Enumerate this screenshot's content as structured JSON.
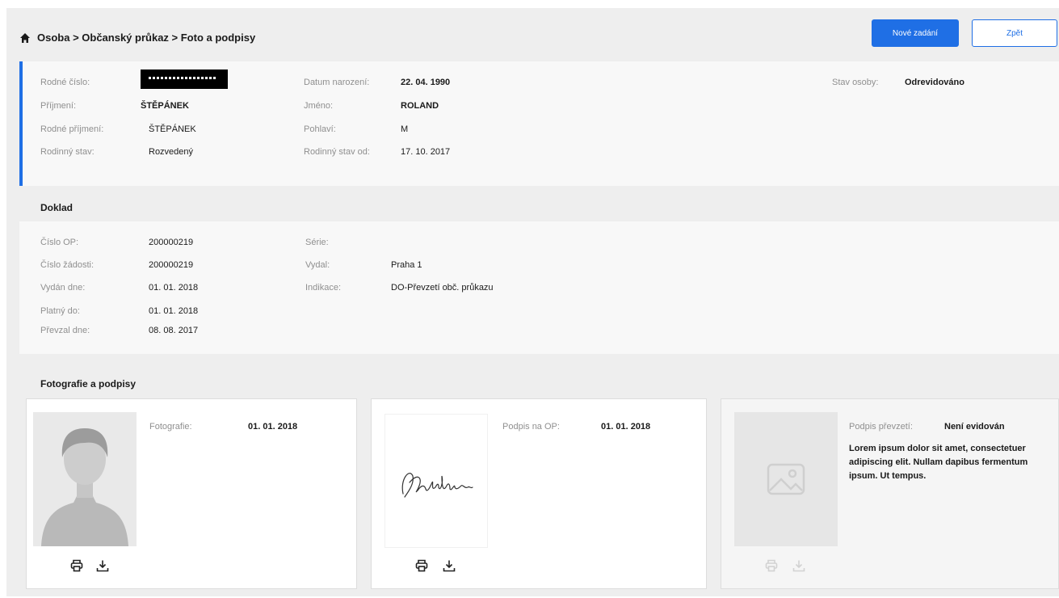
{
  "header": {
    "breadcrumb": "Osoba > Občanský průkaz > Foto a podpisy",
    "new_entry_label": "Nové zadání",
    "back_label": "Zpět"
  },
  "person": {
    "rodne_cislo_label": "Rodné číslo:",
    "prijmeni_label": "Příjmení:",
    "prijmeni": "ŠTĚPÁNEK",
    "rodne_prijmeni_label": "Rodné příjmení:",
    "rodne_prijmeni": "ŠTĚPÁNEK",
    "rodinny_stav_label": "Rodinný stav:",
    "rodinny_stav": "Rozvedený",
    "datum_narozeni_label": "Datum narození:",
    "datum_narozeni": "22. 04. 1990",
    "jmeno_label": "Jméno:",
    "jmeno": "ROLAND",
    "pohlavi_label": "Pohlaví:",
    "pohlavi": "M",
    "rodinny_stav_od_label": "Rodinný stav od:",
    "rodinny_stav_od": "17. 10. 2017",
    "stav_osoby_label": "Stav osoby:",
    "stav_osoby": "Odrevidováno"
  },
  "doklad": {
    "title": "Doklad",
    "cislo_op_label": "Číslo OP:",
    "cislo_op": "200000219",
    "cislo_zadosti_label": "Číslo žádosti:",
    "cislo_zadosti": "200000219",
    "vydan_dne_label": "Vydán dne:",
    "vydan_dne": "01. 01. 2018",
    "platny_do_label": "Platný do:",
    "platny_do": "01. 01. 2018",
    "prevzal_dne_label": "Převzal dne:",
    "prevzal_dne": "08. 08. 2017",
    "serie_label": "Série:",
    "vydal_label": "Vydal:",
    "vydal": "Praha 1",
    "indikace_label": "Indikace:",
    "indikace": "DO-Převzetí obč. průkazu"
  },
  "photos": {
    "title": "Fotografie a podpisy",
    "photo_label": "Fotografie:",
    "photo_date": "01. 01. 2018",
    "signature_label": "Podpis na OP:",
    "signature_date": "01. 01. 2018",
    "pickup_label": "Podpis převzetí:",
    "pickup_value": "Není evidován",
    "lorem": "Lorem ipsum dolor sit amet, consectetuer adipiscing elit. Nullam dapibus fermentum ipsum. Ut tempus."
  },
  "colors": {
    "accent": "#1f6fe5",
    "background": "#eeeeee",
    "panel": "#f8f8f8"
  }
}
